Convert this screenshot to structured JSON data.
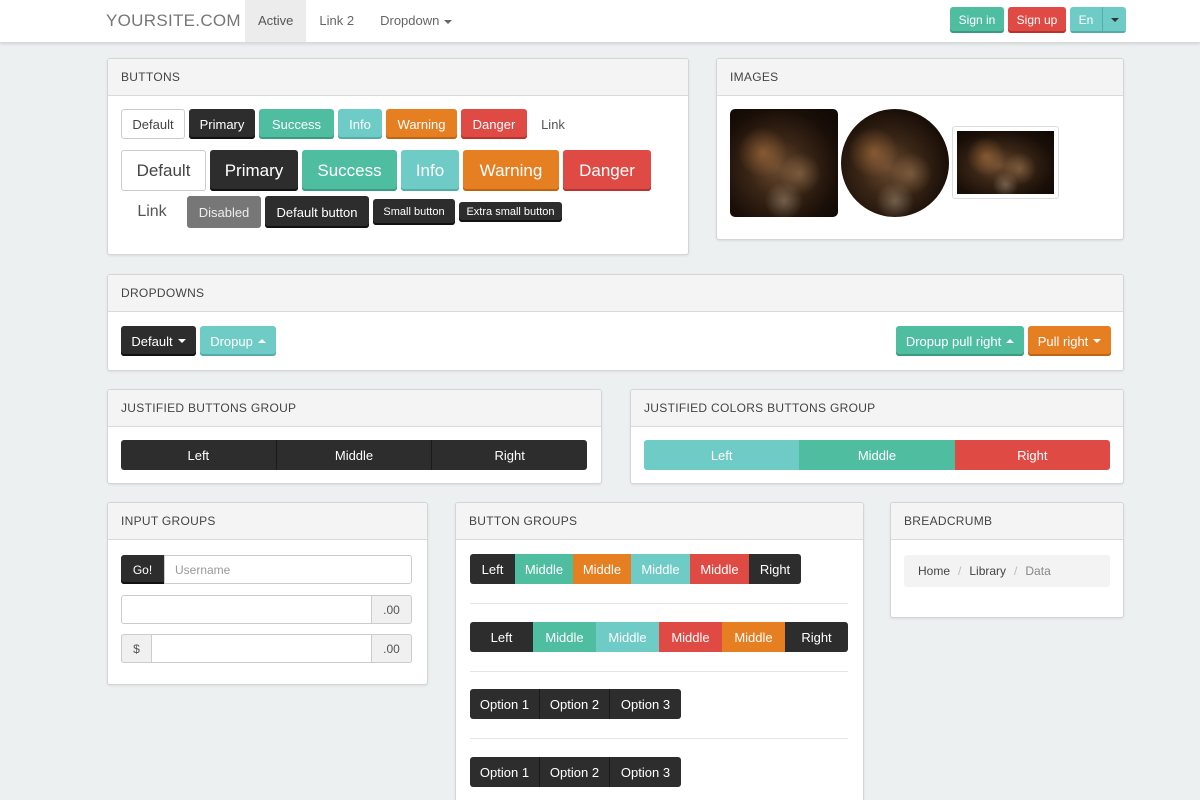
{
  "navbar": {
    "brand": "YOURSITE.COM",
    "links": [
      {
        "label": "Active"
      },
      {
        "label": "Link 2"
      },
      {
        "label": "Dropdown"
      }
    ],
    "signin": "Sign in",
    "signup": "Sign up",
    "language": "En"
  },
  "buttons": {
    "title": "BUTTONS",
    "row1": [
      "Default",
      "Primary",
      "Success",
      "Info",
      "Warning",
      "Danger",
      "Link"
    ],
    "row2": [
      "Default",
      "Primary",
      "Success",
      "Info",
      "Warning",
      "Danger"
    ],
    "row3": [
      "Link",
      "Disabled",
      "Default button",
      "Small button",
      "Extra small button"
    ]
  },
  "images": {
    "title": "IMAGES"
  },
  "dropdowns": {
    "title": "DROPDOWNS",
    "default": "Default",
    "dropup": "Dropup",
    "dropup_right": "Dropup pull right",
    "pull_right": "Pull right"
  },
  "justified": {
    "title": "JUSTIFIED BUTTONS GROUP",
    "items": [
      "Left",
      "Middle",
      "Right"
    ]
  },
  "justified_colors": {
    "title": "JUSTIFIED COLORS BUTTONS GROUP",
    "items": [
      "Left",
      "Middle",
      "Right"
    ]
  },
  "input_groups": {
    "title": "INPUT GROUPS",
    "go": "Go!",
    "username_placeholder": "Username",
    "cents": ".00",
    "dollar": "$"
  },
  "button_groups": {
    "title": "BUTTON GROUPS",
    "row1": [
      "Left",
      "Middle",
      "Middle",
      "Middle",
      "Middle",
      "Right"
    ],
    "row2": [
      "Left",
      "Middle",
      "Middle",
      "Middle",
      "Middle",
      "Right"
    ],
    "options": [
      "Option 1",
      "Option 2",
      "Option 3"
    ]
  },
  "breadcrumb": {
    "title": "BREADCRUMB",
    "items": [
      "Home",
      "Library",
      "Data"
    ]
  },
  "colors": {
    "primary": "#2d2d2d",
    "success": "#4fbea0",
    "info": "#6fcbc6",
    "warning": "#e67e22",
    "danger": "#e04a44",
    "background": "#ecf0f1"
  }
}
